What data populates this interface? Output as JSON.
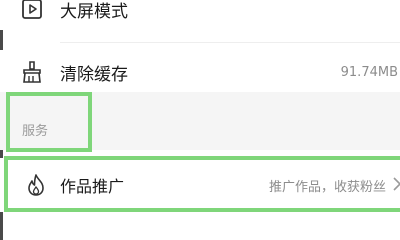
{
  "settings": {
    "big_screen_mode": {
      "label": "大屏模式",
      "icon": "play-square-icon"
    },
    "clear_cache": {
      "label": "清除缓存",
      "value": "91.74MB",
      "icon": "broom-icon"
    }
  },
  "services": {
    "section_title": "服务",
    "promotion": {
      "label": "作品推广",
      "description": "推广作品，收获粉丝",
      "icon": "flame-icon",
      "chevron": "chevron-right-icon"
    }
  },
  "colors": {
    "highlight": "#7fd67a",
    "section_bg": "#f5f5f5",
    "muted_text": "#8c8c8c"
  }
}
